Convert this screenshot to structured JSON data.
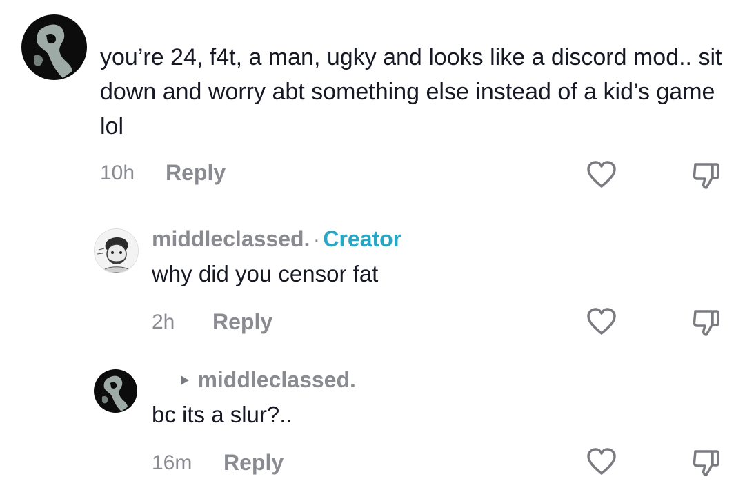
{
  "comments": [
    {
      "avatar": "dark-ghost-avatar",
      "text": "you’re 24, f4t, a man, ugky and looks like a discord mod.. sit down and worry abt something else instead of a kid’s game lol",
      "time": "10h",
      "reply_label": "Reply",
      "like_icon": "heart-outline-icon",
      "dislike_icon": "thumbs-down-outline-icon"
    },
    {
      "avatar": "sketch-portrait-avatar",
      "username": "middleclassed.",
      "separator": "·",
      "badge": "Creator",
      "text": "why did you censor fat",
      "time": "2h",
      "reply_label": "Reply",
      "like_icon": "heart-outline-icon",
      "dislike_icon": "thumbs-down-outline-icon"
    },
    {
      "avatar": "dark-ghost-avatar",
      "reply_to_arrow": "play-triangle-icon",
      "reply_to": "middleclassed.",
      "text": "bc its a slur?..",
      "time": "16m",
      "reply_label": "Reply",
      "like_icon": "heart-outline-icon",
      "dislike_icon": "thumbs-down-outline-icon"
    }
  ],
  "colors": {
    "text": "#161823",
    "muted": "#8a8b91",
    "creator": "#2aa6c5",
    "background": "#ffffff"
  }
}
